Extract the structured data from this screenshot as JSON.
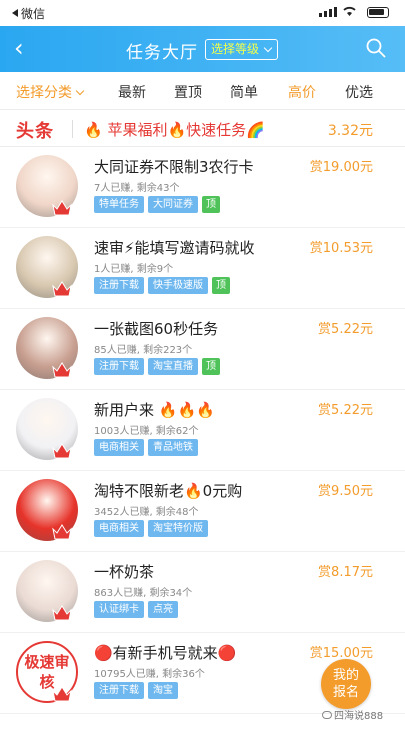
{
  "status_bar": {
    "back_app": "微信"
  },
  "nav": {
    "title": "任务大厅",
    "level_label": "选择等级"
  },
  "filters": [
    {
      "label": "选择分类"
    },
    {
      "label": "最新"
    },
    {
      "label": "置顶"
    },
    {
      "label": "简单"
    },
    {
      "label": "高价"
    },
    {
      "label": "优选"
    }
  ],
  "headline": {
    "tag": "头条",
    "text": "🔥 苹果福利🔥快速任务🌈",
    "amount": "3.32元"
  },
  "tasks": [
    {
      "title": "大同证券不限制3农行卡",
      "meta": "7人已赚, 剩余43个",
      "reward": "赏19.00元",
      "badges": [
        "特单任务",
        "大同证券"
      ],
      "pinned": "顶",
      "avatar_color": "#f0d6c8"
    },
    {
      "title": "速审⚡能填写邀请码就收",
      "meta": "1人已赚, 剩余9个",
      "reward": "赏10.53元",
      "badges": [
        "注册下载",
        "快手极速版"
      ],
      "pinned": "顶",
      "avatar_color": "#d8c8b0"
    },
    {
      "title": "一张截图60秒任务",
      "meta": "85人已赚, 剩余223个",
      "reward": "赏5.22元",
      "badges": [
        "注册下载",
        "淘宝直播"
      ],
      "pinned": "顶",
      "avatar_color": "#c89f90"
    },
    {
      "title": "新用户来 🔥🔥🔥",
      "meta": "1003人已赚, 剩余62个",
      "reward": "赏5.22元",
      "badges": [
        "电商相关",
        "青品地铁"
      ],
      "pinned": "",
      "avatar_color": "#f1f1f4"
    },
    {
      "title": "淘特不限新老🔥0元购",
      "meta": "3452人已赚, 剩余48个",
      "reward": "赏9.50元",
      "badges": [
        "电商相关",
        "淘宝特价版"
      ],
      "pinned": "",
      "avatar_color": "#e6332a"
    },
    {
      "title": "一杯奶茶",
      "meta": "863人已赚, 剩余34个",
      "reward": "赏8.17元",
      "badges": [
        "认证绑卡",
        "点亮"
      ],
      "pinned": "",
      "avatar_color": "#eadbd4"
    },
    {
      "title": "🔴有新手机号就来🔴",
      "meta": "10795人已赚, 剩余36个",
      "reward": "赏15.00元",
      "badges": [
        "注册下载",
        "淘宝"
      ],
      "pinned": "",
      "avatar_color": "#e53935",
      "avatar_text": "极速审核"
    }
  ],
  "fab": {
    "line1": "我的",
    "line2": "报名"
  },
  "watermark": "四海说888",
  "colors": {
    "nav": "#2aa7f1",
    "accent": "#f39c2c",
    "badge": "#6fb8ef",
    "pinned": "#4fc35a",
    "headline": "#e53935"
  }
}
